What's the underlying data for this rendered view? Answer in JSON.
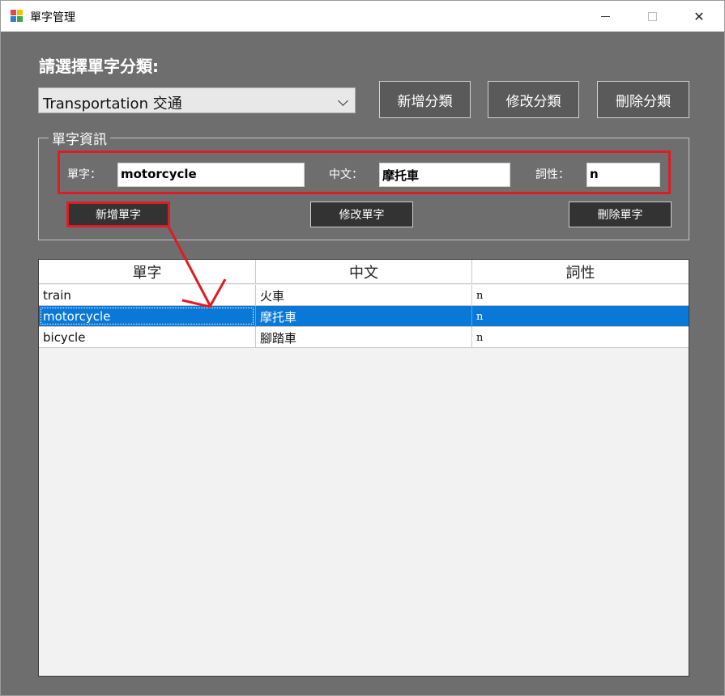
{
  "window": {
    "title": "單字管理",
    "close_glyph": "✕"
  },
  "category": {
    "label": "請選擇單字分類:",
    "selected": "Transportation 交通",
    "add_button": "新增分類",
    "edit_button": "修改分類",
    "delete_button": "刪除分類"
  },
  "word_info": {
    "legend": "單字資訊",
    "word_label": "單字：",
    "word_value": "motorcycle",
    "chinese_label": "中文：",
    "chinese_value": "摩托車",
    "pos_label": "詞性：",
    "pos_value": "n",
    "add_button": "新增單字",
    "edit_button": "修改單字",
    "delete_button": "刪除單字"
  },
  "table": {
    "columns": [
      "單字",
      "中文",
      "詞性"
    ],
    "rows": [
      {
        "word": "train",
        "chinese": "火車",
        "pos": "n",
        "selected": false
      },
      {
        "word": "motorcycle",
        "chinese": "摩托車",
        "pos": "n",
        "selected": true
      },
      {
        "word": "bicycle",
        "chinese": "腳踏車",
        "pos": "n",
        "selected": false
      }
    ]
  },
  "colors": {
    "annotation_red": "#e01b24",
    "selection_blue": "#0a78d7",
    "background_gray": "#6e6e6e"
  }
}
